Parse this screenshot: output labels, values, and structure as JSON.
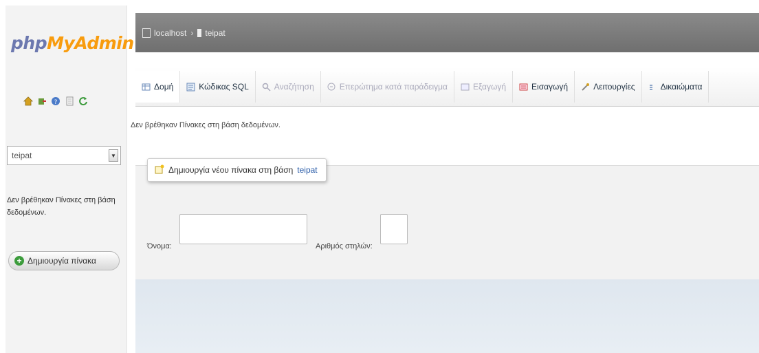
{
  "sidebar": {
    "logo_php": "php",
    "logo_myadmin": "MyAdmin",
    "nav_icons": [
      "home-icon",
      "exit-icon",
      "help-icon",
      "docs-icon",
      "reload-icon"
    ],
    "db_select_value": "teipat",
    "no_tables_text": "Δεν βρέθηκαν Πίνακες στη βάση δεδομένων.",
    "create_table_label": "Δημιουργία πίνακα"
  },
  "breadcrumb": {
    "server": "localhost",
    "database": "teipat"
  },
  "tabs": [
    {
      "label": "Δομή",
      "icon": "structure-icon",
      "state": "active"
    },
    {
      "label": "Κώδικας SQL",
      "icon": "sql-icon",
      "state": "normal"
    },
    {
      "label": "Αναζήτηση",
      "icon": "search-icon",
      "state": "disabled"
    },
    {
      "label": "Επερώτημα κατά παράδειγμα",
      "icon": "query-icon",
      "state": "disabled"
    },
    {
      "label": "Εξαγωγή",
      "icon": "export-icon",
      "state": "disabled"
    },
    {
      "label": "Εισαγωγή",
      "icon": "import-icon",
      "state": "normal"
    },
    {
      "label": "Λειτουργίες",
      "icon": "operations-icon",
      "state": "normal"
    },
    {
      "label": "Δικαιώματα",
      "icon": "privileges-icon",
      "state": "normal"
    }
  ],
  "main": {
    "no_tables_text": "Δεν βρέθηκαν Πίνακες στη βάση δεδομένων.",
    "create_legend_text": "Δημιουργία νέου πίνακα στη βάση",
    "create_legend_db": "teipat",
    "name_label": "Όνομα:",
    "name_value": "",
    "columns_label": "Αριθμός στηλών:",
    "columns_value": ""
  },
  "colors": {
    "topbar": "#777777",
    "accent_php": "#6c78af",
    "accent_myadmin": "#f89c0e",
    "link": "#2a5ca8"
  }
}
